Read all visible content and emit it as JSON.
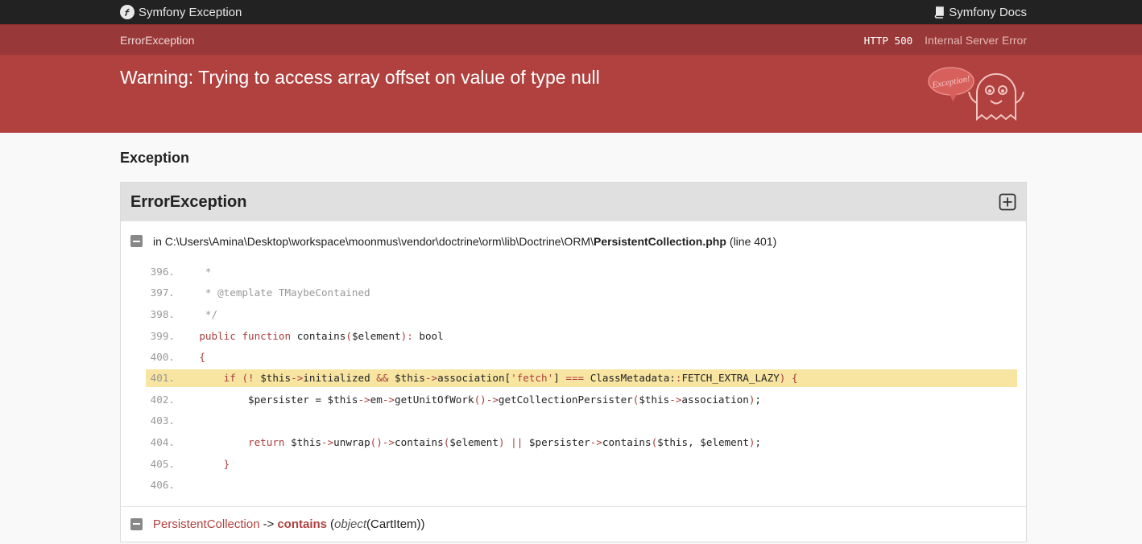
{
  "topbar": {
    "brand": "Symfony Exception",
    "docs": "Symfony Docs"
  },
  "status": {
    "exception_class": "ErrorException",
    "http_code": "HTTP 500",
    "http_text": "Internal Server Error"
  },
  "message": "Warning: Trying to access array offset on value of type null",
  "ghost": {
    "bubble_text": "Exception!"
  },
  "section_title": "Exception",
  "trace": {
    "class": "ErrorException",
    "file_prefix": "in",
    "file_path": "C:\\Users\\Amina\\Desktop\\workspace\\moonmus\\vendor\\doctrine\\orm\\lib\\Doctrine\\ORM\\",
    "file_name": "PersistentCollection.php",
    "file_line": "(line 401)",
    "code_lines": [
      {
        "num": "396.",
        "code": "     *"
      },
      {
        "num": "397.",
        "code": "     * @template TMaybeContained"
      },
      {
        "num": "398.",
        "code": "     */"
      },
      {
        "num": "399.",
        "code": "    public function contains($element): bool"
      },
      {
        "num": "400.",
        "code": "    {"
      },
      {
        "num": "401.",
        "code": "        if (! $this->initialized && $this->association['fetch'] === ClassMetadata::FETCH_EXTRA_LAZY) {",
        "selected": true
      },
      {
        "num": "402.",
        "code": "            $persister = $this->em->getUnitOfWork()->getCollectionPersister($this->association);"
      },
      {
        "num": "403.",
        "code": ""
      },
      {
        "num": "404.",
        "code": "            return $this->unwrap()->contains($element) || $persister->contains($this, $element);"
      },
      {
        "num": "405.",
        "code": "        }"
      },
      {
        "num": "406.",
        "code": ""
      }
    ],
    "call": {
      "class": "PersistentCollection",
      "arrow": "->",
      "method": "contains",
      "arg_type": "object",
      "arg_class": "(CartItem)"
    }
  },
  "colors": {
    "topbar": "#222222",
    "header_red": "#b0413e",
    "status_red": "#993838",
    "highlight": "#f7e5a1"
  }
}
